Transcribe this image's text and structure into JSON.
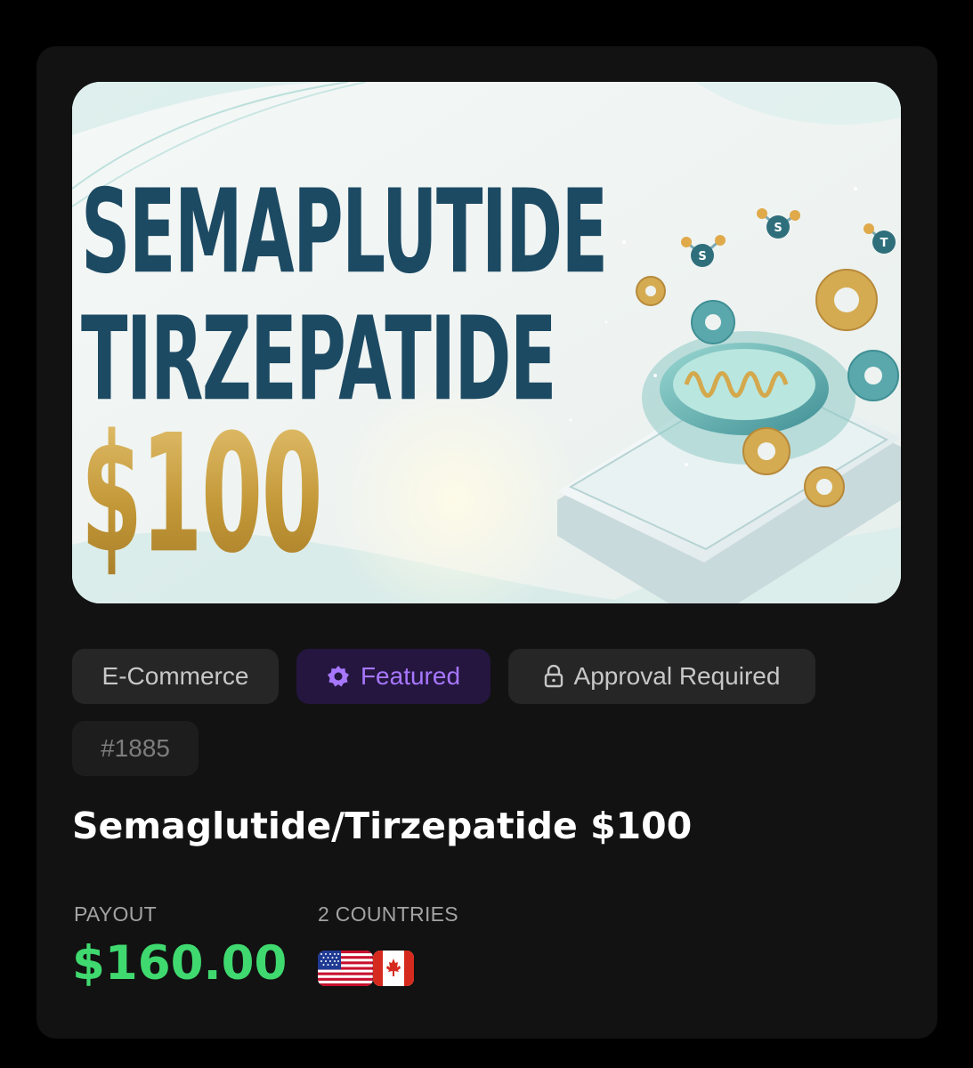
{
  "banner": {
    "headline_line1": "SEMAPLUTIDE",
    "headline_line2": "TIRZEPATIDE",
    "headline_price": "$100",
    "molecule_letters": [
      "S",
      "S",
      "T"
    ]
  },
  "tags": {
    "category": "E-Commerce",
    "featured": "Featured",
    "featured_icon": "badge-star-icon",
    "approval": "Approval Required",
    "approval_icon": "lock-icon",
    "offer_id": "#1885"
  },
  "offer": {
    "title": "Semaglutide/Tirzepatide $100"
  },
  "payout": {
    "label": "PAYOUT",
    "amount": "$160.00"
  },
  "countries": {
    "label": "2 COUNTRIES",
    "flags": [
      "us-flag-icon",
      "canada-flag-icon"
    ]
  },
  "colors": {
    "page_background": "#000000",
    "card_background": "#121212",
    "tag_background": "#262626",
    "featured_background": "#24163f",
    "featured_text": "#a777ff",
    "payout_amount": "#3fd96f",
    "headline_navy": "#1d4a63",
    "headline_gold": "#c89f45"
  }
}
